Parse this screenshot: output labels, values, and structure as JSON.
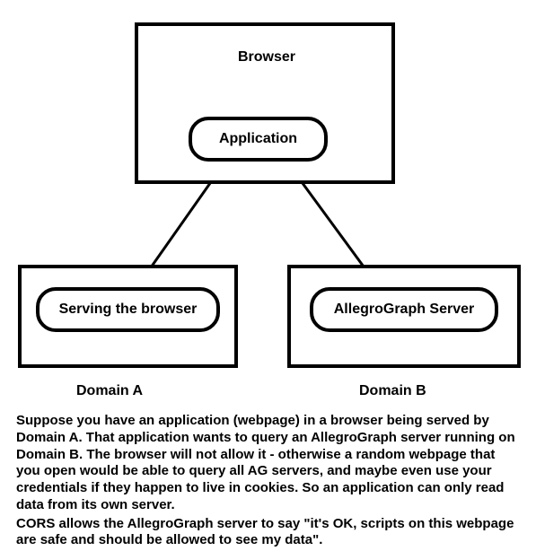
{
  "diagram": {
    "browser_label": "Browser",
    "application_label": "Application",
    "serving_label": "Serving the browser",
    "ag_label": "AllegroGraph Server",
    "domain_a_label": "Domain A",
    "domain_b_label": "Domain B"
  },
  "footer": {
    "p1": "Suppose you have an application (webpage) in a browser being served by Domain A. That application wants to query an AllegroGraph server running on Domain B. The browser will not allow it - otherwise a random webpage that you open would be able to query all AG servers, and maybe even use your credentials if they happen to live in cookies. So an application can only read data from its own server.",
    "p2": "CORS allows the AllegroGraph server to say \"it's OK, scripts on this webpage are safe and should be allowed to see my data\"."
  }
}
